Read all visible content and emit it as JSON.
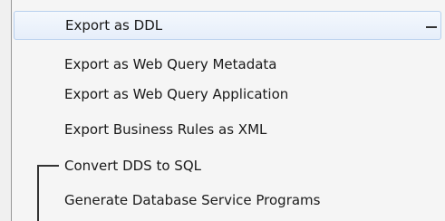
{
  "menu": {
    "items": [
      {
        "label": "Export as DDL"
      },
      {
        "label": "Export as Web Query Metadata"
      },
      {
        "label": "Export as Web Query Application"
      },
      {
        "label": "Export Business Rules as XML"
      },
      {
        "label": "Convert DDS to SQL"
      },
      {
        "label": "Generate Database Service Programs"
      }
    ],
    "highlighted_index": 0
  }
}
